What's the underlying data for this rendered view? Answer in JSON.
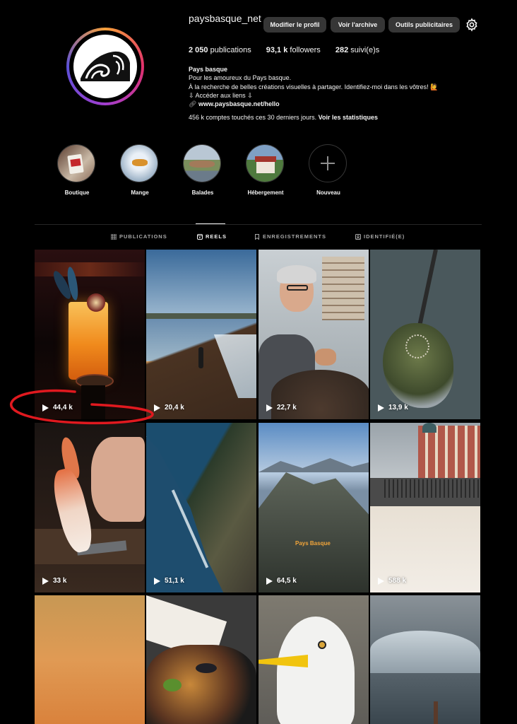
{
  "profile": {
    "username": "paysbasque_net",
    "buttons": {
      "edit": "Modifier le profil",
      "archive": "Voir l'archive",
      "ads": "Outils publicitaires"
    },
    "stats": {
      "posts_value": "2 050",
      "posts_label": "publications",
      "followers_value": "93,1 k",
      "followers_label": "followers",
      "following_value": "282",
      "following_label": "suivi(e)s"
    },
    "bio": {
      "name": "Pays basque",
      "line1": "Pour les amoureux du Pays basque.",
      "line2": "À la recherche de belles créations visuelles à partager. Identifiez-moi dans les vôtres! 🙋",
      "line3": "⇩ Accéder aux liens ⇩",
      "link": "www.paysbasque.net/hello"
    },
    "reach_text": "456 k comptes touchés ces 30 derniers jours.",
    "reach_link": "Voir les statistiques"
  },
  "highlights": [
    "Boutique",
    "Mange",
    "Balades",
    "Hébergement",
    "Nouveau"
  ],
  "tabs": [
    "PUBLICATIONS",
    "REELS",
    "ENREGISTREMENTS",
    "IDENTIFIÉ(E)"
  ],
  "active_tab": "REELS",
  "reels": [
    {
      "views": "44,4 k",
      "subject": "cocktail"
    },
    {
      "views": "20,4 k",
      "subject": "beach-sunset"
    },
    {
      "views": "22,7 k",
      "subject": "artisan"
    },
    {
      "views": "13,9 k",
      "subject": "coast-aerial"
    },
    {
      "views": "33 k",
      "subject": "crab"
    },
    {
      "views": "51,1 k",
      "subject": "cliffs-aerial"
    },
    {
      "views": "64,5 k",
      "subject": "mountain",
      "overlay_text": "Pays Basque"
    },
    {
      "views": "588 k",
      "subject": "palace-foam"
    },
    {
      "views": "",
      "subject": "sunset-sky"
    },
    {
      "views": "",
      "subject": "seafood-dish"
    },
    {
      "views": "",
      "subject": "seagull"
    },
    {
      "views": "",
      "subject": "wave"
    }
  ],
  "annotation": {
    "color": "#e0191f",
    "target": "reel-1-view-count"
  },
  "colors": {
    "background": "#000000",
    "button": "#363636",
    "muted": "#a8a8a8"
  }
}
